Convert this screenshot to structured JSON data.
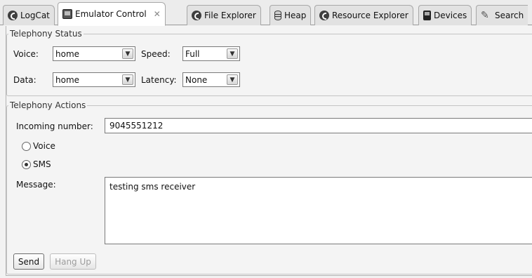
{
  "tabs": [
    {
      "label": "LogCat",
      "icon": "android-icon"
    },
    {
      "label": "Emulator Control",
      "icon": "emulator-screen-icon",
      "active": true
    },
    {
      "label": "File Explorer",
      "icon": "android-icon"
    },
    {
      "label": "Heap",
      "icon": "heap-icon"
    },
    {
      "label": "Resource Explorer",
      "icon": "android-icon"
    },
    {
      "label": "Devices",
      "icon": "device-icon"
    },
    {
      "label": "Search",
      "icon": "search-icon"
    }
  ],
  "close_glyph": "✕",
  "telephony_status": {
    "legend": "Telephony Status",
    "voice_label": "Voice:",
    "voice_value": "home",
    "speed_label": "Speed:",
    "speed_value": "Full",
    "data_label": "Data:",
    "data_value": "home",
    "latency_label": "Latency:",
    "latency_value": "None"
  },
  "telephony_actions": {
    "legend": "Telephony Actions",
    "incoming_label": "Incoming number:",
    "incoming_value": "9045551212",
    "voice_radio": {
      "label": "Voice",
      "checked": false
    },
    "sms_radio": {
      "label": "SMS",
      "checked": true
    },
    "message_label": "Message:",
    "message_value": "testing sms receiver",
    "send_label": "Send",
    "hangup_label": "Hang Up"
  },
  "colors": {
    "background": "#f2f2f2",
    "border": "#7a7a7a"
  }
}
